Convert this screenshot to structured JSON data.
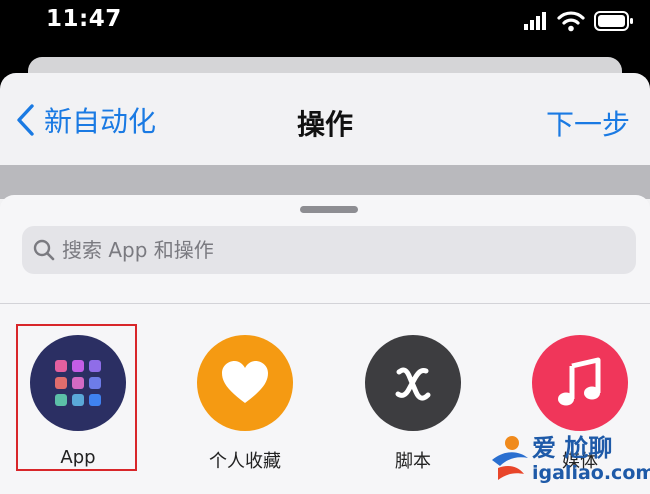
{
  "status_bar": {
    "time": "11:47",
    "icons": [
      "signal-icon",
      "wifi-icon",
      "battery-icon"
    ]
  },
  "nav": {
    "back_label": "新自动化",
    "title": "操作",
    "next_label": "下一步",
    "accent_color": "#1a7ae3"
  },
  "search": {
    "placeholder": "搜索 App 和操作",
    "value": ""
  },
  "categories": [
    {
      "label": "App",
      "icon": "app-grid-icon",
      "color": "#2b2f63",
      "selected": true
    },
    {
      "label": "个人收藏",
      "icon": "heart-icon",
      "color": "#f59a12"
    },
    {
      "label": "脚本",
      "icon": "script-x-icon",
      "color": "#3d3d40"
    },
    {
      "label": "媒体",
      "icon": "music-note-icon",
      "color": "#f0365a"
    }
  ],
  "highlight_color": "#d8262a",
  "watermark": {
    "text_top": "爱 尬聊",
    "text_bottom": "igaliao.com"
  }
}
